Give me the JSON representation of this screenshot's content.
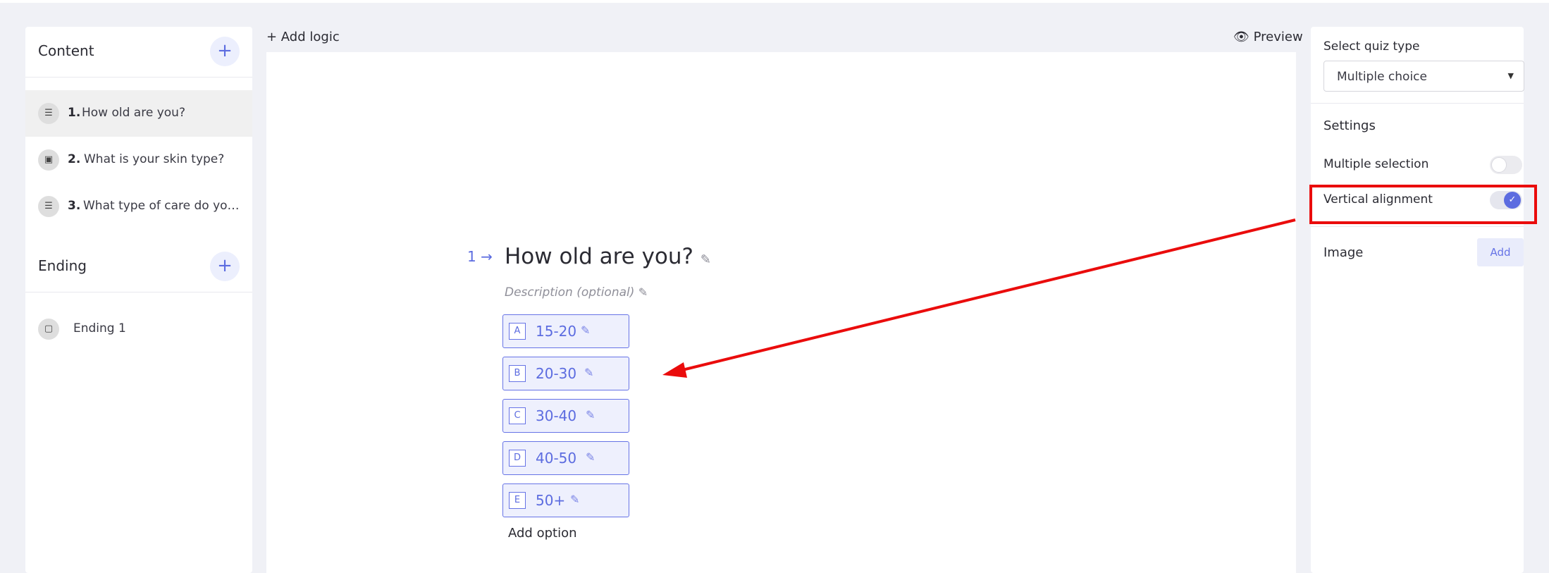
{
  "sidebar": {
    "content_title": "Content",
    "ending_title": "Ending",
    "questions": [
      {
        "num": "1.",
        "label": "How old are you?",
        "icon": "list-icon"
      },
      {
        "num": "2.",
        "label": "What is your skin type?",
        "icon": "image-choice-icon"
      },
      {
        "num": "3.",
        "label": "What type of care do you prefer?",
        "icon": "list-icon"
      }
    ],
    "endings": [
      {
        "label": "Ending 1",
        "icon": "ending-icon"
      }
    ]
  },
  "toolbar": {
    "add_logic": "+ Add logic",
    "preview": "Preview"
  },
  "question": {
    "index": "1",
    "title": "How old are you?",
    "description_placeholder": "Description (optional)",
    "options": [
      {
        "key": "A",
        "value": "15-20"
      },
      {
        "key": "B",
        "value": "20-30"
      },
      {
        "key": "C",
        "value": "30-40"
      },
      {
        "key": "D",
        "value": "40-50"
      },
      {
        "key": "E",
        "value": "50+"
      }
    ],
    "add_option": "Add option"
  },
  "panel": {
    "quiz_type_label": "Select quiz type",
    "quiz_type_value": "Multiple choice",
    "settings_label": "Settings",
    "multiple_selection_label": "Multiple selection",
    "multiple_selection_on": false,
    "vertical_alignment_label": "Vertical alignment",
    "vertical_alignment_on": true,
    "image_label": "Image",
    "image_add": "Add"
  },
  "colors": {
    "accent": "#5c6ce0",
    "annotation_red": "#ea0c0c",
    "background": "#f0f1f6"
  }
}
